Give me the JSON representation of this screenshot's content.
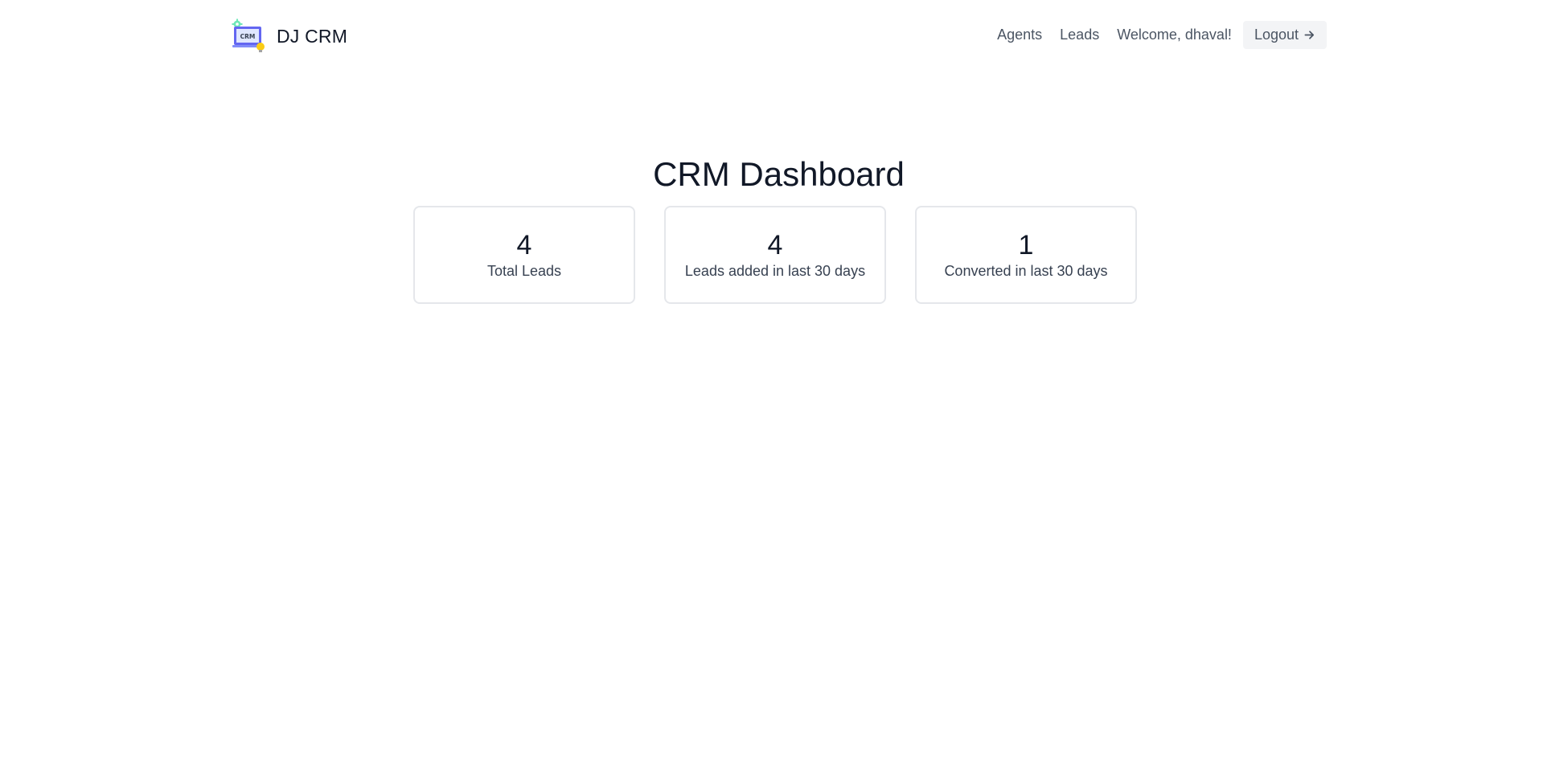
{
  "header": {
    "brand_name": "DJ CRM",
    "logo_text": "CRM",
    "nav": {
      "agents_label": "Agents",
      "leads_label": "Leads",
      "welcome_text": "Welcome, dhaval!",
      "logout_label": "Logout",
      "logout_icon": "arrow-right-icon"
    }
  },
  "main": {
    "title": "CRM Dashboard",
    "stats": [
      {
        "value": "4",
        "label": "Total Leads"
      },
      {
        "value": "4",
        "label": "Leads added in last 30 days"
      },
      {
        "value": "1",
        "label": "Converted in last 30 days"
      }
    ]
  },
  "colors": {
    "text_primary": "#111827",
    "text_secondary": "#4b5563",
    "card_border": "#e5e7eb",
    "button_bg": "#f3f4f6"
  }
}
